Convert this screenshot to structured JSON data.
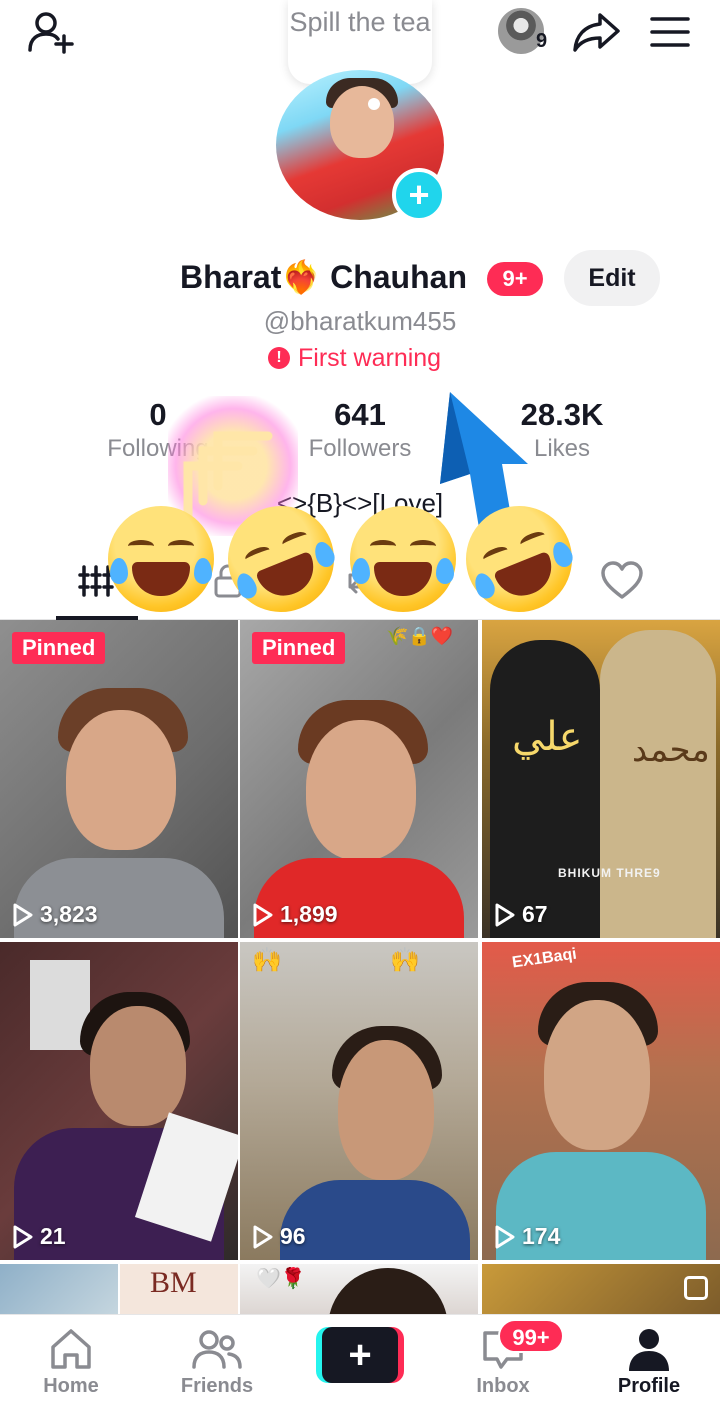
{
  "topbar": {
    "story_count": "9",
    "bubble_text": "Spill the tea"
  },
  "profile": {
    "display_name": "Bharat❤️‍🔥 Chauhan",
    "name_badge": "9+",
    "edit_label": "Edit",
    "username": "@bharatkum455",
    "warning": "First warning",
    "bio": "<>{B}<>[Love]"
  },
  "stats": [
    {
      "value": "0",
      "label": "Following"
    },
    {
      "value": "641",
      "label": "Followers"
    },
    {
      "value": "28.3K",
      "label": "Likes"
    }
  ],
  "tabs": [
    {
      "icon": "videos-grid-icon"
    },
    {
      "icon": "lock-icon"
    },
    {
      "icon": "repost-icon"
    },
    {
      "icon": "favorites-icon"
    },
    {
      "icon": "heart-icon"
    }
  ],
  "videos": [
    {
      "pinned": "Pinned",
      "views": "3,823"
    },
    {
      "pinned": "Pinned",
      "views": "1,899",
      "overlay": "🌾🔒❤️"
    },
    {
      "views": "67",
      "caption": "BHIKUM THRE9"
    },
    {
      "views": "21"
    },
    {
      "views": "96",
      "overlay": "🙌"
    },
    {
      "views": "174",
      "overlay": "EX1Baqi"
    },
    {
      "overlay": "BM"
    },
    {
      "overlay": "🤍🌹"
    },
    {},
    {}
  ],
  "nav": {
    "home": "Home",
    "friends": "Friends",
    "inbox": "Inbox",
    "inbox_badge": "99+",
    "profile": "Profile"
  },
  "colors": {
    "accent": "#fe2c55",
    "create_cyan": "#25f4ee",
    "plus_badge": "#20d5ec",
    "text_primary": "#161823",
    "text_secondary": "#8a8b91"
  }
}
